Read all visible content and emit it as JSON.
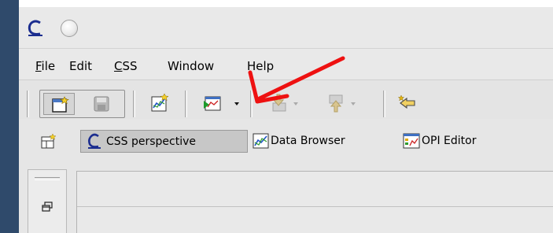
{
  "menu": {
    "file": {
      "label": "File",
      "mnemonic": "F",
      "rest": "ile"
    },
    "edit": {
      "label": "Edit"
    },
    "css": {
      "label": "CSS",
      "mnemonic": "C",
      "rest": "SS"
    },
    "window": {
      "label": "Window"
    },
    "help": {
      "label": "Help"
    }
  },
  "toolbar": {
    "icons": [
      "new-window-icon",
      "save-icon",
      "data-browser-new-icon",
      "opi-run-icon",
      "dropdown-arrow-icon",
      "download-icon",
      "upload-icon",
      "back-arrow-icon"
    ]
  },
  "perspectives": {
    "open_icon": "open-perspective-icon",
    "items": [
      {
        "label": "CSS perspective",
        "icon": "css-logo-icon",
        "active": true
      },
      {
        "label": "Data Browser",
        "icon": "data-browser-icon",
        "active": false
      },
      {
        "label": "OPI Editor",
        "icon": "opi-editor-icon",
        "active": false
      }
    ]
  },
  "colors": {
    "annotation_arrow": "#ee1111",
    "desktop_strip": "#2f4a6b",
    "active_tab": "#c7c7c7"
  }
}
